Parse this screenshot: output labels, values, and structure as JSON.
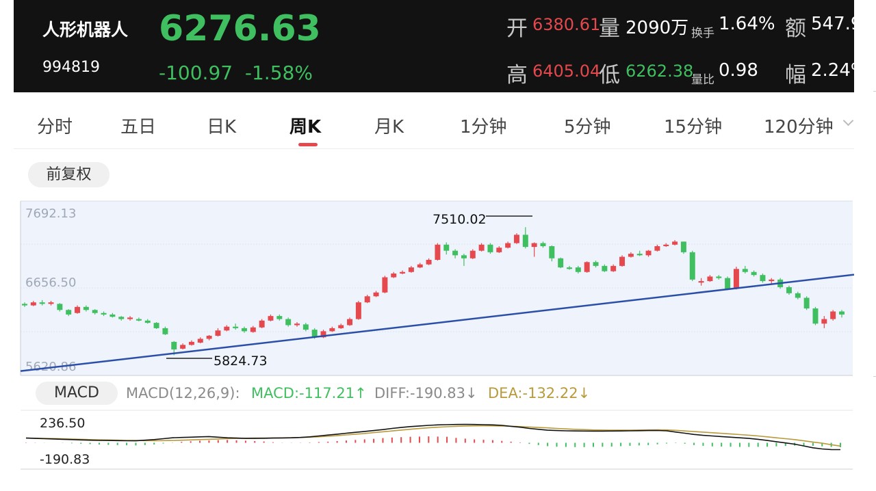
{
  "header": {
    "stock_name": "人形机器人",
    "stock_code": "994819",
    "price": "6276.63",
    "change": "-100.97",
    "change_pct": "-1.58%",
    "open_label": "开",
    "open_value": "6380.61",
    "volume_label": "量",
    "volume_value": "2090万",
    "turnover_label": "换手",
    "turnover_value": "1.64%",
    "amount_label": "额",
    "amount_value": "547.9",
    "high_label": "高",
    "high_value": "6405.04",
    "low_label": "低",
    "low_value": "6262.38",
    "vol_ratio_label": "量比",
    "vol_ratio_value": "0.98",
    "amplitude_label": "幅",
    "amplitude_value": "2.24%"
  },
  "tabs": [
    {
      "label": "分时",
      "active": false
    },
    {
      "label": "五日",
      "active": false
    },
    {
      "label": "日K",
      "active": false
    },
    {
      "label": "周K",
      "active": true
    },
    {
      "label": "月K",
      "active": false
    },
    {
      "label": "1分钟",
      "active": false
    },
    {
      "label": "5分钟",
      "active": false
    },
    {
      "label": "15分钟",
      "active": false
    },
    {
      "label": "120分钟",
      "active": false
    }
  ],
  "adjust_button": "前复权",
  "chart_data": {
    "type": "candlestick",
    "y_axis_labels": [
      "7692.13",
      "6656.50",
      "5620.86"
    ],
    "ylim": [
      5620.86,
      7692.13
    ],
    "max_annotation": "7510.02",
    "min_annotation": "5824.73",
    "up_color": "#e5484d",
    "down_color": "#3fbf5f",
    "trendline_color": "#2b4fa8",
    "trendline": {
      "start_index": 0,
      "start_value": 5615,
      "end_index": 79,
      "end_value": 6680
    },
    "candles": [
      [
        6500,
        6480,
        6520,
        6460
      ],
      [
        6480,
        6520,
        6540,
        6470
      ],
      [
        6520,
        6500,
        6550,
        6480
      ],
      [
        6500,
        6520,
        6540,
        6480
      ],
      [
        6500,
        6420,
        6510,
        6400
      ],
      [
        6420,
        6360,
        6430,
        6340
      ],
      [
        6380,
        6460,
        6480,
        6370
      ],
      [
        6460,
        6420,
        6480,
        6400
      ],
      [
        6420,
        6380,
        6430,
        6360
      ],
      [
        6380,
        6360,
        6400,
        6340
      ],
      [
        6360,
        6330,
        6380,
        6320
      ],
      [
        6330,
        6300,
        6340,
        6280
      ],
      [
        6300,
        6320,
        6340,
        6280
      ],
      [
        6300,
        6280,
        6320,
        6270
      ],
      [
        6280,
        6250,
        6300,
        6240
      ],
      [
        6250,
        6180,
        6260,
        6170
      ],
      [
        6180,
        6100,
        6200,
        6090
      ],
      [
        6000,
        5900,
        6010,
        5825
      ],
      [
        5910,
        5960,
        5980,
        5900
      ],
      [
        5960,
        6000,
        6020,
        5950
      ],
      [
        5990,
        6040,
        6060,
        5980
      ],
      [
        6040,
        6080,
        6090,
        6020
      ],
      [
        6080,
        6150,
        6180,
        6070
      ],
      [
        6150,
        6200,
        6220,
        6140
      ],
      [
        6200,
        6180,
        6240,
        6160
      ],
      [
        6180,
        6140,
        6200,
        6120
      ],
      [
        6130,
        6190,
        6210,
        6120
      ],
      [
        6190,
        6280,
        6300,
        6180
      ],
      [
        6280,
        6340,
        6360,
        6270
      ],
      [
        6340,
        6300,
        6360,
        6280
      ],
      [
        6300,
        6220,
        6320,
        6200
      ],
      [
        6220,
        6240,
        6260,
        6200
      ],
      [
        6230,
        6160,
        6250,
        6140
      ],
      [
        6160,
        6060,
        6180,
        6040
      ],
      [
        6060,
        6140,
        6160,
        6050
      ],
      [
        6140,
        6180,
        6200,
        6130
      ],
      [
        6180,
        6220,
        6240,
        6170
      ],
      [
        6220,
        6300,
        6320,
        6210
      ],
      [
        6300,
        6520,
        6540,
        6290
      ],
      [
        6520,
        6600,
        6620,
        6510
      ],
      [
        6600,
        6650,
        6670,
        6590
      ],
      [
        6650,
        6850,
        6870,
        6640
      ],
      [
        6850,
        6900,
        6920,
        6840
      ],
      [
        6900,
        6920,
        6940,
        6890
      ],
      [
        6920,
        6980,
        7000,
        6910
      ],
      [
        6980,
        7020,
        7040,
        6970
      ],
      [
        7020,
        7080,
        7100,
        7010
      ],
      [
        7080,
        7280,
        7300,
        7070
      ],
      [
        7280,
        7200,
        7310,
        7150
      ],
      [
        7200,
        7140,
        7220,
        7100
      ],
      [
        7140,
        7100,
        7160,
        7000
      ],
      [
        7100,
        7200,
        7220,
        7090
      ],
      [
        7200,
        7280,
        7300,
        7190
      ],
      [
        7280,
        7180,
        7300,
        7160
      ],
      [
        7180,
        7240,
        7260,
        7170
      ],
      [
        7240,
        7300,
        7320,
        7230
      ],
      [
        7300,
        7410,
        7430,
        7290
      ],
      [
        7410,
        7250,
        7510,
        7230
      ],
      [
        7250,
        7300,
        7310,
        7120
      ],
      [
        7300,
        7260,
        7320,
        7240
      ],
      [
        7260,
        7100,
        7270,
        7060
      ],
      [
        7100,
        6980,
        7110,
        6970
      ],
      [
        6980,
        6960,
        7000,
        6950
      ],
      [
        6980,
        6920,
        7000,
        6900
      ],
      [
        6920,
        7050,
        7060,
        6910
      ],
      [
        7050,
        7000,
        7070,
        6980
      ],
      [
        7000,
        6930,
        7020,
        6920
      ],
      [
        6930,
        7000,
        7020,
        6920
      ],
      [
        7000,
        7120,
        7140,
        6990
      ],
      [
        7120,
        7160,
        7180,
        7110
      ],
      [
        7160,
        7140,
        7200,
        7130
      ],
      [
        7140,
        7200,
        7210,
        7120
      ],
      [
        7200,
        7260,
        7280,
        7190
      ],
      [
        7260,
        7280,
        7300,
        7250
      ],
      [
        7280,
        7320,
        7340,
        7270
      ],
      [
        7320,
        7180,
        7320,
        7160
      ],
      [
        7180,
        6820,
        7200,
        6800
      ],
      [
        6780,
        6800,
        6840,
        6740
      ],
      [
        6800,
        6860,
        6880,
        6790
      ],
      [
        6860,
        6840,
        6880,
        6820
      ],
      [
        6840,
        6700,
        6860,
        6680
      ],
      [
        6700,
        6960,
        6990,
        6690
      ],
      [
        6960,
        6920,
        7000,
        6900
      ],
      [
        6920,
        6880,
        6940,
        6860
      ],
      [
        6880,
        6800,
        6900,
        6780
      ],
      [
        6800,
        6820,
        6840,
        6760
      ],
      [
        6820,
        6720,
        6840,
        6700
      ],
      [
        6720,
        6640,
        6740,
        6620
      ],
      [
        6640,
        6580,
        6660,
        6560
      ],
      [
        6580,
        6440,
        6600,
        6420
      ],
      [
        6440,
        6240,
        6460,
        6220
      ],
      [
        6240,
        6300,
        6340,
        6180
      ],
      [
        6300,
        6400,
        6420,
        6280
      ],
      [
        6400,
        6360,
        6420,
        6320
      ]
    ]
  },
  "macd": {
    "button_label": "MACD",
    "params": "MACD(12,26,9):",
    "macd_text": "MACD:-117.21↑",
    "diff_text": "DIFF:-190.83↓",
    "dea_text": "DEA:-132.22↓",
    "macd_color": "#3fbf5f",
    "diff_color": "#888888",
    "dea_color": "#b89a3a",
    "axis_top": "236.50",
    "axis_bottom": "-190.83",
    "ylim": [
      -190.83,
      236.5
    ],
    "hist": [
      8,
      5,
      3,
      0,
      -5,
      -15,
      -25,
      -35,
      -45,
      -55,
      -60,
      -65,
      -70,
      -60,
      -45,
      -20,
      5,
      25,
      40,
      55,
      60,
      70,
      75,
      65,
      55,
      45,
      35,
      15,
      -5,
      -5,
      5,
      10,
      20,
      30,
      45,
      60,
      75,
      90,
      105,
      125,
      140,
      150,
      160,
      165,
      170,
      165,
      160,
      130,
      110,
      90,
      80,
      70,
      50,
      30,
      10,
      -30,
      -60,
      -90,
      -105,
      -110,
      -115,
      -115,
      -110,
      -105,
      -100,
      -90,
      -80,
      -70,
      -60,
      -40,
      -20,
      -10,
      -25,
      -60,
      -80,
      -95,
      -100,
      -105,
      -110,
      -110,
      -108,
      -105,
      -95,
      -85,
      -75,
      -70,
      -80,
      -95,
      -110,
      -117
    ],
    "diff": [
      0,
      -5,
      -10,
      -15,
      -20,
      -25,
      -30,
      -35,
      -38,
      -40,
      -42,
      -44,
      -45,
      -35,
      -25,
      -10,
      5,
      10,
      15,
      20,
      25,
      15,
      5,
      0,
      -5,
      -5,
      -3,
      0,
      2,
      5,
      10,
      20,
      35,
      50,
      65,
      80,
      95,
      110,
      125,
      140,
      160,
      175,
      190,
      200,
      210,
      218,
      222,
      225,
      226,
      225,
      222,
      218,
      210,
      195,
      180,
      160,
      145,
      130,
      125,
      120,
      118,
      116,
      115,
      115,
      116,
      118,
      120,
      122,
      125,
      126,
      120,
      100,
      80,
      60,
      45,
      35,
      25,
      15,
      5,
      -5,
      -20,
      -40,
      -60,
      -80,
      -100,
      -130,
      -160,
      -180,
      -190,
      -190.83
    ],
    "dea": [
      0,
      -2,
      -5,
      -8,
      -12,
      -16,
      -20,
      -25,
      -29,
      -32,
      -35,
      -38,
      -40,
      -42,
      -43,
      -42,
      -40,
      -35,
      -30,
      -25,
      -20,
      -15,
      -10,
      -5,
      -2,
      0,
      1,
      2,
      4,
      6,
      10,
      15,
      22,
      30,
      40,
      52,
      64,
      76,
      90,
      104,
      118,
      132,
      146,
      158,
      170,
      180,
      188,
      195,
      200,
      203,
      204,
      203,
      200,
      196,
      190,
      183,
      175,
      168,
      160,
      152,
      145,
      140,
      135,
      132,
      130,
      130,
      131,
      133,
      135,
      137,
      135,
      128,
      118,
      108,
      98,
      88,
      78,
      68,
      58,
      48,
      35,
      20,
      5,
      -10,
      -25,
      -45,
      -65,
      -85,
      -110,
      -132.22
    ]
  }
}
